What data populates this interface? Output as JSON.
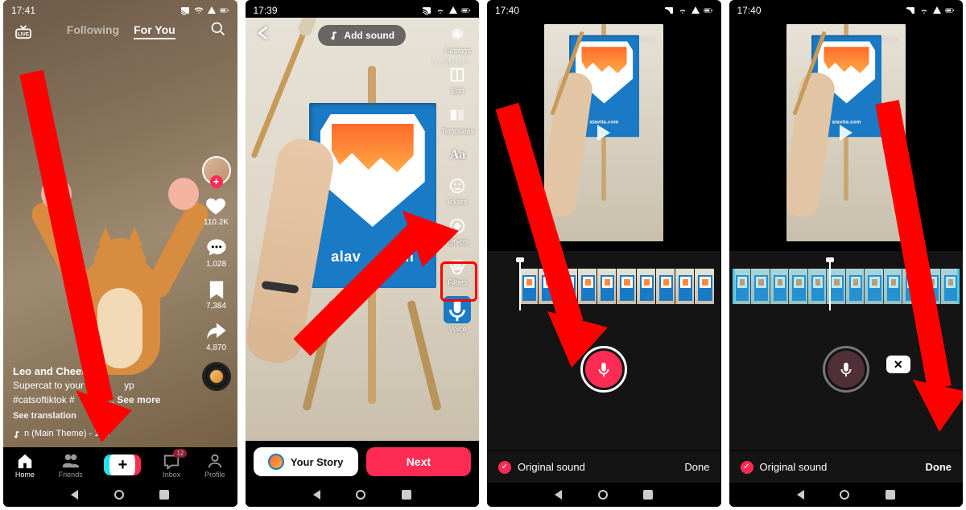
{
  "status": {
    "times": [
      "17:41",
      "17:39",
      "17:40",
      "17:40"
    ],
    "icons": [
      "cast-icon",
      "wifi-icon",
      "signal-icon",
      "battery-icon",
      "square-icon"
    ]
  },
  "s1": {
    "tabs": {
      "following": "Following",
      "foryou": "For You"
    },
    "username": "Leo and Cheeto",
    "caption_line1": "Supercat to your res",
    "caption_badge": "yp",
    "caption_line2": "#catsoftiktok #",
    "caption_cut": "ec...",
    "see_more": "See more",
    "see_translation": "See translation",
    "sound": "n (Main Theme) - 101",
    "likes": "110.2K",
    "comments": "1,028",
    "saves": "7,384",
    "shares": "4,870",
    "tabbar": {
      "home": "Home",
      "friends": "Friends",
      "inbox": "Inbox",
      "inbox_badge": "12",
      "profile": "Profile"
    }
  },
  "s2": {
    "add_sound": "Add sound",
    "watermark": "inMelo",
    "canvas_text": "alav",
    "canvas_text2": ".com",
    "rail": [
      {
        "key": "settings",
        "label": "Settings"
      },
      {
        "key": "edit",
        "label": "Edit"
      },
      {
        "key": "templates",
        "label": "Templates"
      },
      {
        "key": "text",
        "label": "Aa"
      },
      {
        "key": "stickers",
        "label": "ickers"
      },
      {
        "key": "effects",
        "label": "Effects"
      },
      {
        "key": "filters",
        "label": "Filters"
      },
      {
        "key": "voice",
        "label": "Voice"
      }
    ],
    "your_story": "Your Story",
    "next": "Next"
  },
  "s3": {
    "watermark": "inMelo",
    "original_sound": "Original sound",
    "done": "Done",
    "canvas_text": "alavita.com"
  },
  "s4": {
    "watermark": "inMelo",
    "original_sound": "Original sound",
    "done": "Done",
    "canvas_text": "alavita.com"
  }
}
